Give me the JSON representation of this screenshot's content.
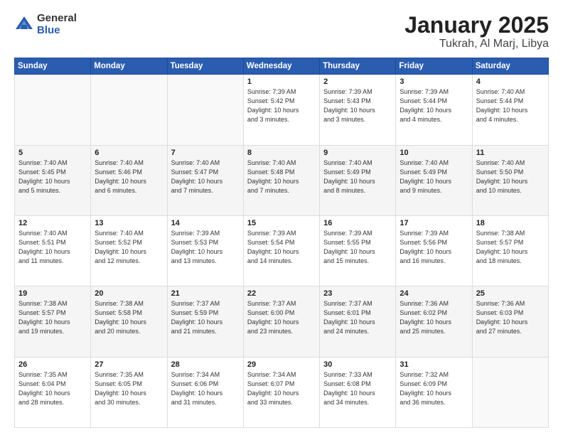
{
  "logo": {
    "general": "General",
    "blue": "Blue"
  },
  "header": {
    "title": "January 2025",
    "subtitle": "Tukrah, Al Marj, Libya"
  },
  "weekdays": [
    "Sunday",
    "Monday",
    "Tuesday",
    "Wednesday",
    "Thursday",
    "Friday",
    "Saturday"
  ],
  "weeks": [
    [
      {
        "day": "",
        "info": ""
      },
      {
        "day": "",
        "info": ""
      },
      {
        "day": "",
        "info": ""
      },
      {
        "day": "1",
        "info": "Sunrise: 7:39 AM\nSunset: 5:42 PM\nDaylight: 10 hours\nand 3 minutes."
      },
      {
        "day": "2",
        "info": "Sunrise: 7:39 AM\nSunset: 5:43 PM\nDaylight: 10 hours\nand 3 minutes."
      },
      {
        "day": "3",
        "info": "Sunrise: 7:39 AM\nSunset: 5:44 PM\nDaylight: 10 hours\nand 4 minutes."
      },
      {
        "day": "4",
        "info": "Sunrise: 7:40 AM\nSunset: 5:44 PM\nDaylight: 10 hours\nand 4 minutes."
      }
    ],
    [
      {
        "day": "5",
        "info": "Sunrise: 7:40 AM\nSunset: 5:45 PM\nDaylight: 10 hours\nand 5 minutes."
      },
      {
        "day": "6",
        "info": "Sunrise: 7:40 AM\nSunset: 5:46 PM\nDaylight: 10 hours\nand 6 minutes."
      },
      {
        "day": "7",
        "info": "Sunrise: 7:40 AM\nSunset: 5:47 PM\nDaylight: 10 hours\nand 7 minutes."
      },
      {
        "day": "8",
        "info": "Sunrise: 7:40 AM\nSunset: 5:48 PM\nDaylight: 10 hours\nand 7 minutes."
      },
      {
        "day": "9",
        "info": "Sunrise: 7:40 AM\nSunset: 5:49 PM\nDaylight: 10 hours\nand 8 minutes."
      },
      {
        "day": "10",
        "info": "Sunrise: 7:40 AM\nSunset: 5:49 PM\nDaylight: 10 hours\nand 9 minutes."
      },
      {
        "day": "11",
        "info": "Sunrise: 7:40 AM\nSunset: 5:50 PM\nDaylight: 10 hours\nand 10 minutes."
      }
    ],
    [
      {
        "day": "12",
        "info": "Sunrise: 7:40 AM\nSunset: 5:51 PM\nDaylight: 10 hours\nand 11 minutes."
      },
      {
        "day": "13",
        "info": "Sunrise: 7:40 AM\nSunset: 5:52 PM\nDaylight: 10 hours\nand 12 minutes."
      },
      {
        "day": "14",
        "info": "Sunrise: 7:39 AM\nSunset: 5:53 PM\nDaylight: 10 hours\nand 13 minutes."
      },
      {
        "day": "15",
        "info": "Sunrise: 7:39 AM\nSunset: 5:54 PM\nDaylight: 10 hours\nand 14 minutes."
      },
      {
        "day": "16",
        "info": "Sunrise: 7:39 AM\nSunset: 5:55 PM\nDaylight: 10 hours\nand 15 minutes."
      },
      {
        "day": "17",
        "info": "Sunrise: 7:39 AM\nSunset: 5:56 PM\nDaylight: 10 hours\nand 16 minutes."
      },
      {
        "day": "18",
        "info": "Sunrise: 7:38 AM\nSunset: 5:57 PM\nDaylight: 10 hours\nand 18 minutes."
      }
    ],
    [
      {
        "day": "19",
        "info": "Sunrise: 7:38 AM\nSunset: 5:57 PM\nDaylight: 10 hours\nand 19 minutes."
      },
      {
        "day": "20",
        "info": "Sunrise: 7:38 AM\nSunset: 5:58 PM\nDaylight: 10 hours\nand 20 minutes."
      },
      {
        "day": "21",
        "info": "Sunrise: 7:37 AM\nSunset: 5:59 PM\nDaylight: 10 hours\nand 21 minutes."
      },
      {
        "day": "22",
        "info": "Sunrise: 7:37 AM\nSunset: 6:00 PM\nDaylight: 10 hours\nand 23 minutes."
      },
      {
        "day": "23",
        "info": "Sunrise: 7:37 AM\nSunset: 6:01 PM\nDaylight: 10 hours\nand 24 minutes."
      },
      {
        "day": "24",
        "info": "Sunrise: 7:36 AM\nSunset: 6:02 PM\nDaylight: 10 hours\nand 25 minutes."
      },
      {
        "day": "25",
        "info": "Sunrise: 7:36 AM\nSunset: 6:03 PM\nDaylight: 10 hours\nand 27 minutes."
      }
    ],
    [
      {
        "day": "26",
        "info": "Sunrise: 7:35 AM\nSunset: 6:04 PM\nDaylight: 10 hours\nand 28 minutes."
      },
      {
        "day": "27",
        "info": "Sunrise: 7:35 AM\nSunset: 6:05 PM\nDaylight: 10 hours\nand 30 minutes."
      },
      {
        "day": "28",
        "info": "Sunrise: 7:34 AM\nSunset: 6:06 PM\nDaylight: 10 hours\nand 31 minutes."
      },
      {
        "day": "29",
        "info": "Sunrise: 7:34 AM\nSunset: 6:07 PM\nDaylight: 10 hours\nand 33 minutes."
      },
      {
        "day": "30",
        "info": "Sunrise: 7:33 AM\nSunset: 6:08 PM\nDaylight: 10 hours\nand 34 minutes."
      },
      {
        "day": "31",
        "info": "Sunrise: 7:32 AM\nSunset: 6:09 PM\nDaylight: 10 hours\nand 36 minutes."
      },
      {
        "day": "",
        "info": ""
      }
    ]
  ]
}
